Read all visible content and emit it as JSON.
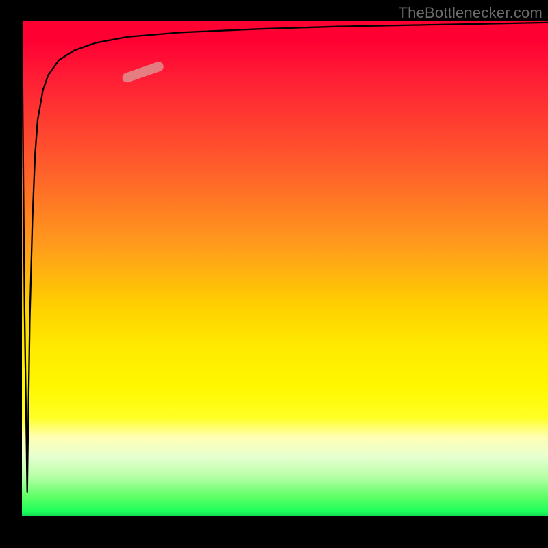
{
  "watermark": "TheBottlenecker.com",
  "chart_data": {
    "type": "line",
    "title": "",
    "xlabel": "",
    "ylabel": "",
    "xlim": [
      0,
      100
    ],
    "ylim": [
      0,
      100
    ],
    "series": [
      {
        "name": "curve",
        "x": [
          0,
          0.5,
          1,
          1.5,
          2,
          2.5,
          3,
          4,
          5,
          7,
          10,
          14,
          20,
          30,
          45,
          60,
          80,
          100
        ],
        "values": [
          100,
          42,
          5,
          40,
          60,
          73,
          80,
          86,
          89,
          92,
          94,
          95.5,
          96.7,
          97.6,
          98.3,
          98.8,
          99.2,
          99.6
        ]
      }
    ],
    "marker": {
      "name": "highlight-segment",
      "x": [
        20,
        26
      ],
      "values": [
        88.5,
        90.7
      ]
    },
    "background_gradient_stops": [
      {
        "pos": 0.0,
        "color": "#ff0033"
      },
      {
        "pos": 0.3,
        "color": "#ff5f2b"
      },
      {
        "pos": 0.58,
        "color": "#ffd200"
      },
      {
        "pos": 0.8,
        "color": "#ffff24"
      },
      {
        "pos": 0.92,
        "color": "#b6ffa6"
      },
      {
        "pos": 1.0,
        "color": "#17d557"
      }
    ]
  }
}
